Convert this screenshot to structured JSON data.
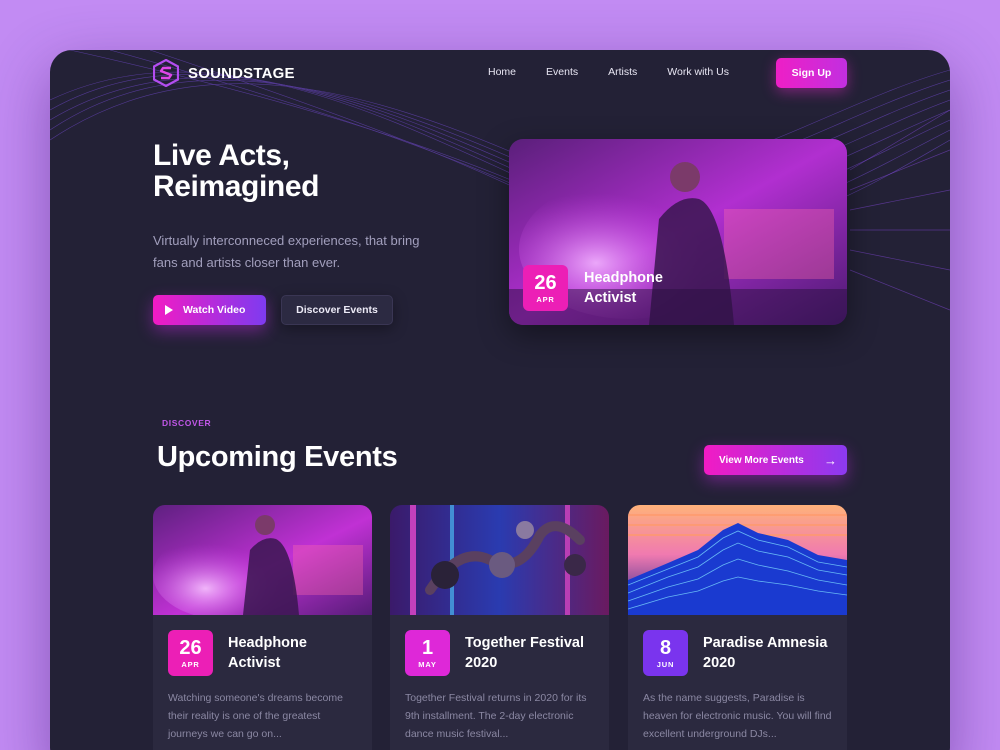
{
  "brand": {
    "name_bold": "SOUND",
    "name_rest": "STAGE"
  },
  "nav": {
    "items": [
      "Home",
      "Events",
      "Artists",
      "Work with Us"
    ],
    "signup_label": "Sign Up"
  },
  "hero": {
    "title_line1": "Live Acts,",
    "title_line2": "Reimagined",
    "subtitle": "Virtually interconneced experiences, that bring fans and artists closer than ever.",
    "watch_label": "Watch Video",
    "discover_label": "Discover Events",
    "featured": {
      "day": "26",
      "month": "APR",
      "title": "Headphone Activist"
    }
  },
  "section": {
    "eyebrow": "DISCOVER",
    "title": "Upcoming Events",
    "more_label": "View More Events"
  },
  "events": [
    {
      "day": "26",
      "month": "APR",
      "title": "Headphone Activist",
      "desc": "Watching someone's dreams become their reality is one of the greatest journeys we can go on..."
    },
    {
      "day": "1",
      "month": "MAY",
      "title": "Together Festival 2020",
      "desc": "Together Festival returns in 2020 for its 9th installment. The 2-day electronic dance music festival..."
    },
    {
      "day": "8",
      "month": "JUN",
      "title": "Paradise Amnesia 2020",
      "desc": "As the name suggests, Paradise is heaven for electronic music. You will find excellent underground DJs..."
    }
  ],
  "colors": {
    "accent_pink": "#ec1fb6",
    "accent_purple": "#7a34ee",
    "background": "#232136",
    "card": "#2b293f"
  }
}
